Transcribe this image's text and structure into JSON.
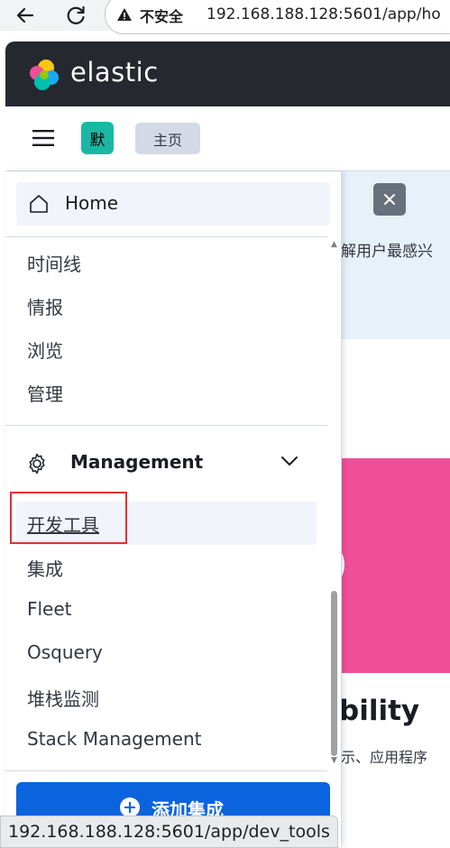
{
  "browser": {
    "security_label": "不安全",
    "url": "192.168.188.128:5601/app/ho"
  },
  "header": {
    "brand": "elastic"
  },
  "subheader": {
    "space_avatar": "默",
    "breadcrumb": "主页"
  },
  "background_page": {
    "callout_text": "解用户最感兴",
    "title_fragment": "bility",
    "subtitle_fragment": "示、应用程序"
  },
  "nav": {
    "home_label": "Home",
    "analytics_items": [
      "时间线",
      "情报",
      "浏览",
      "管理"
    ],
    "management_label": "Management",
    "management_items": [
      "开发工具",
      "集成",
      "Fleet",
      "Osquery",
      "堆栈监测",
      "Stack Management"
    ],
    "add_integration_label": "添加集成"
  },
  "status_bar": {
    "url": "192.168.188.128:5601/app/dev_tools"
  },
  "colors": {
    "header_bg": "#25282f",
    "accent": "#0b64dd",
    "pink": "#f04e98",
    "highlight": "#e0322f"
  }
}
